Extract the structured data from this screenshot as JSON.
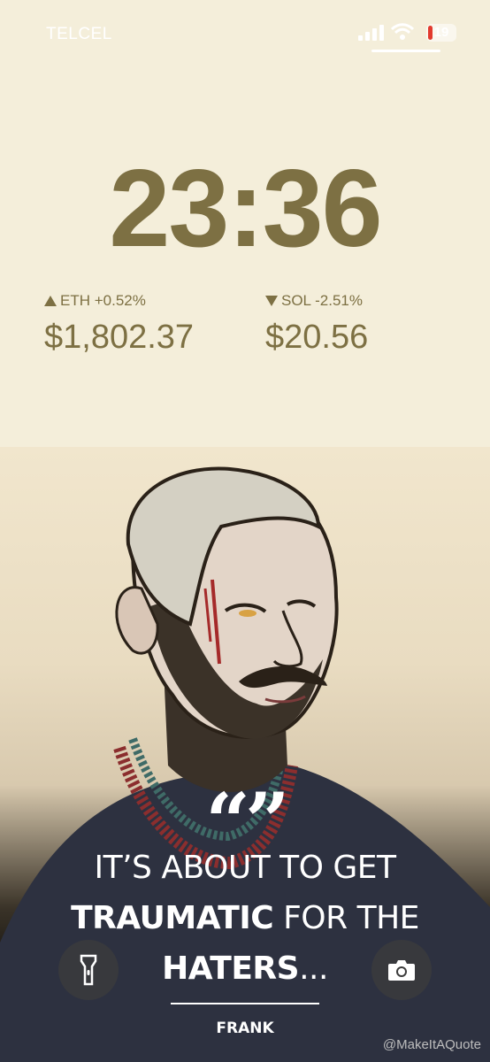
{
  "status_bar": {
    "carrier": "TELCEL",
    "battery_level": "19",
    "icons": [
      "signal-icon",
      "wifi-icon",
      "battery-icon"
    ]
  },
  "clock": {
    "time": "23:36"
  },
  "widgets": [
    {
      "direction": "up",
      "label": "ETH +0.52%",
      "price": "$1,802.37"
    },
    {
      "direction": "down",
      "label": "SOL -2.51%",
      "price": "$20.56"
    }
  ],
  "quote": {
    "marks": "“”",
    "line1": "IT’S ABOUT TO GET",
    "line2_bold": "TRAUMATIC",
    "line2_rest": " FOR THE",
    "line3_bold": "HATERS",
    "line3_rest": "...",
    "author": "FRANK"
  },
  "buttons": {
    "flashlight": "flashlight-icon",
    "camera": "camera-icon"
  },
  "watermark": "@MakeItAQuote",
  "colors": {
    "accent": "#7d7043",
    "background": "#f4eeda",
    "battery_low": "#e23a2e"
  }
}
